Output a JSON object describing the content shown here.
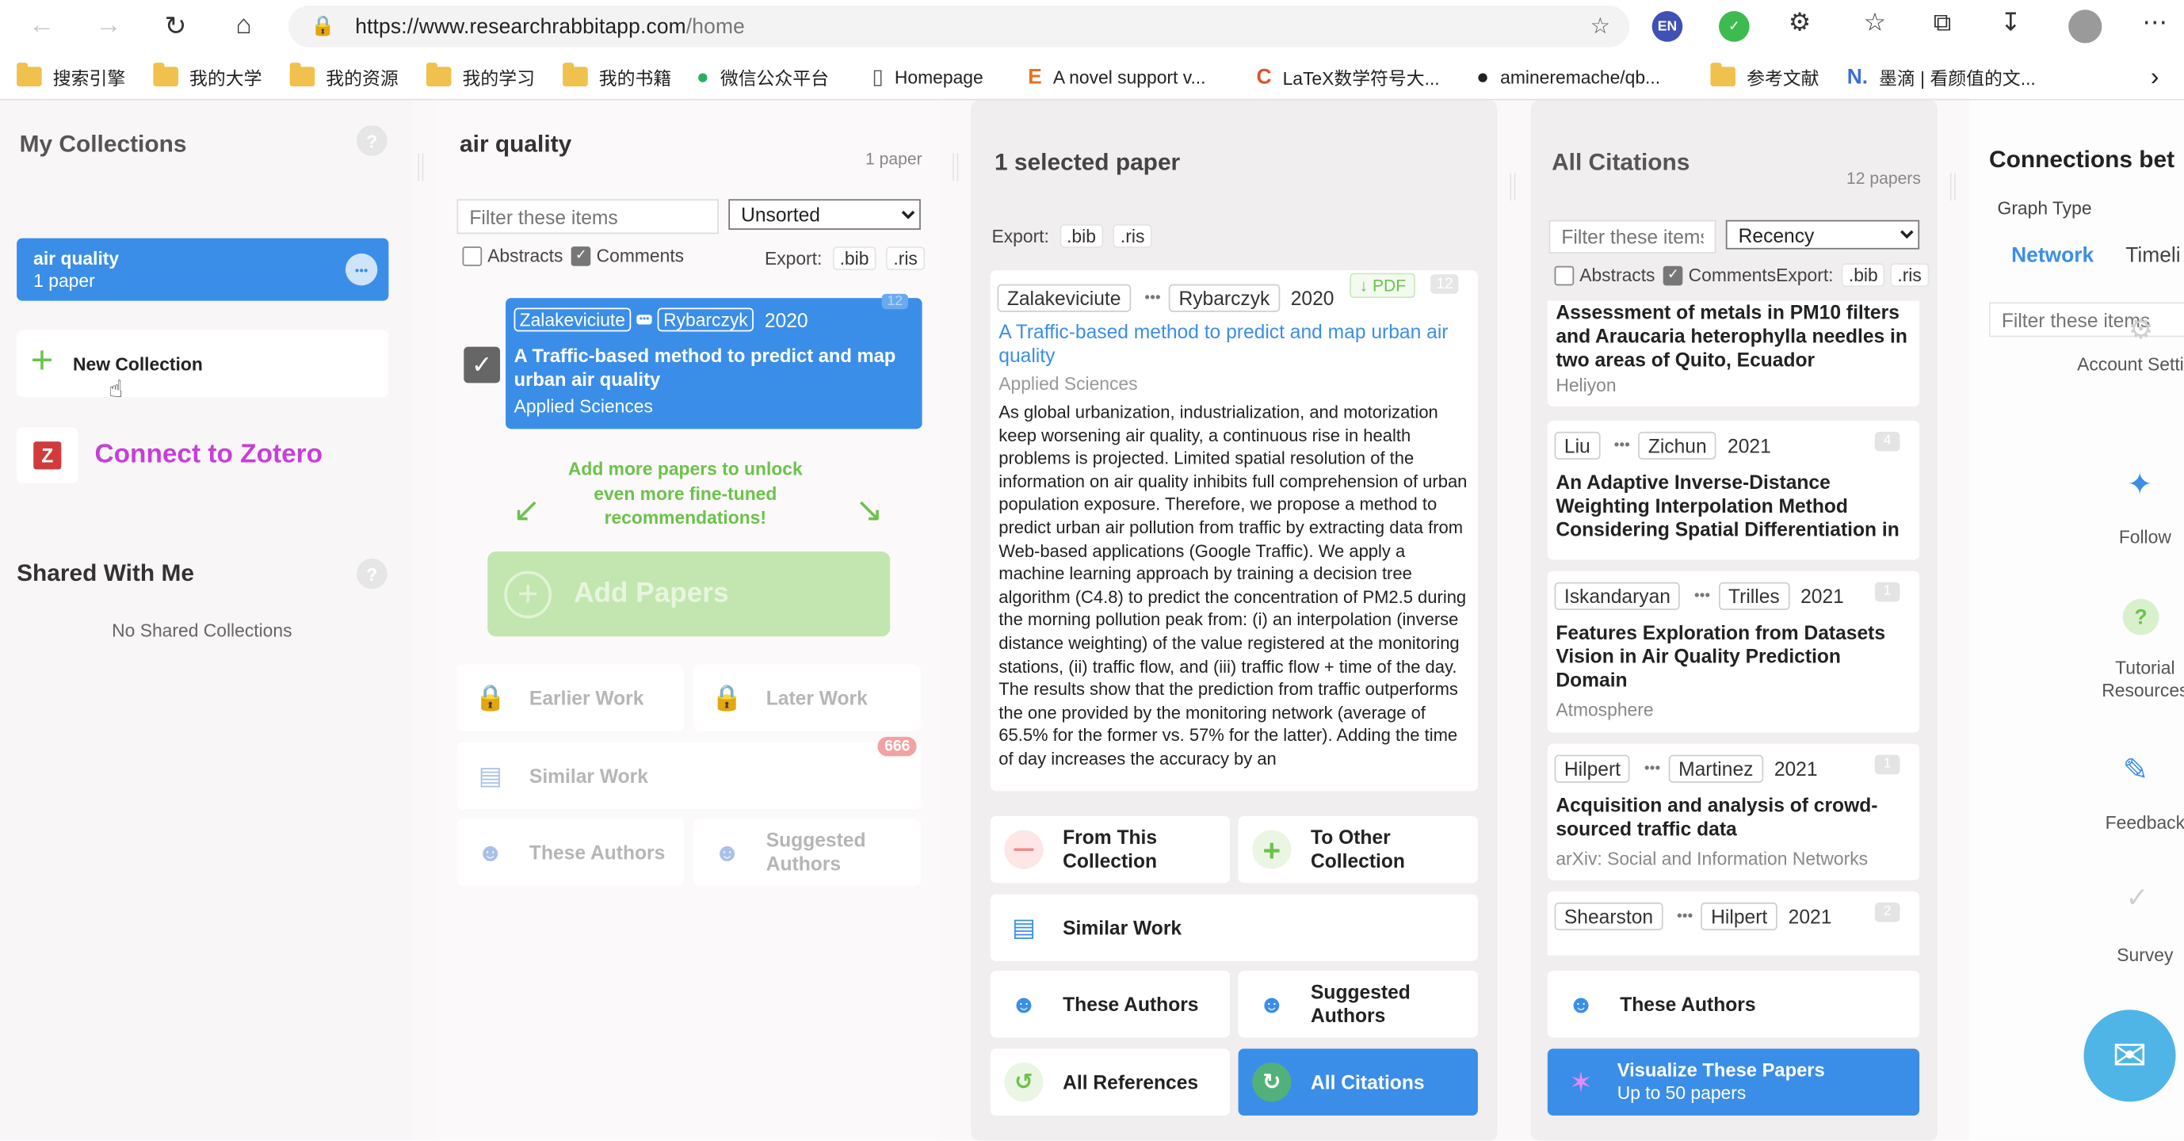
{
  "browser": {
    "url_host": "https://www.researchrabbitapp.com",
    "url_path": "/home",
    "bookmarks": [
      {
        "label": "搜索引擎",
        "icon": "folder-icon"
      },
      {
        "label": "我的大学",
        "icon": "folder-icon"
      },
      {
        "label": "我的资源",
        "icon": "folder-icon"
      },
      {
        "label": "我的学习",
        "icon": "folder-icon"
      },
      {
        "label": "我的书籍",
        "icon": "folder-icon"
      },
      {
        "label": "微信公众平台",
        "icon": "wechat-icon"
      },
      {
        "label": "Homepage",
        "icon": "page-icon"
      },
      {
        "label": "A novel support v...",
        "icon": "elsevier-icon"
      },
      {
        "label": "LaTeX数学符号大...",
        "icon": "csdn-icon"
      },
      {
        "label": "amineremache/qb...",
        "icon": "github-icon"
      },
      {
        "label": "参考文献",
        "icon": "folder-icon"
      },
      {
        "label": "墨滴 | 看颜值的文...",
        "icon": "mdnice-icon"
      }
    ],
    "ext_lang": "EN"
  },
  "collections": {
    "title": "My Collections",
    "help": "?",
    "active": {
      "name": "air quality",
      "count": "1 paper",
      "menu": "•••"
    },
    "new_collection": "New Collection",
    "zotero_letter": "Z",
    "zotero": "Connect to Zotero",
    "shared_title": "Shared With Me",
    "shared_help": "?",
    "shared_empty": "No Shared Collections"
  },
  "collection_panel": {
    "title": "air quality",
    "count": "1 paper",
    "filter_placeholder": "Filter these items",
    "sort": "Unsorted",
    "abstracts": "Abstracts",
    "comments": "Comments",
    "export_label": "Export:",
    "export_bib": ".bib",
    "export_ris": ".ris",
    "paper": {
      "author1": "Zalakeviciute",
      "dots": "•••",
      "author2": "Rybarczyk",
      "year": "2020",
      "cites": "12",
      "title": "A Traffic-based method to predict and map urban air quality",
      "journal": "Applied Sciences"
    },
    "hint": "Add more papers to unlock even more fine-tuned recommendations!",
    "add_papers": "Add Papers",
    "earlier": "Earlier Work",
    "later": "Later Work",
    "similar": "Similar Work",
    "similar_badge": "666",
    "these_authors": "These Authors",
    "suggested_authors": "Suggested Authors"
  },
  "selected": {
    "title": "1 selected paper",
    "export_label": "Export:",
    "export_bib": ".bib",
    "export_ris": ".ris",
    "author1": "Zalakeviciute",
    "dots": "•••",
    "author2": "Rybarczyk",
    "year": "2020",
    "pdf": "PDF",
    "cites": "12",
    "paper_title": "A Traffic-based method to predict and map urban air quality",
    "journal": "Applied Sciences",
    "abstract": "As global urbanization, industrialization, and motorization keep worsening air quality, a continuous rise in health problems is projected. Limited spatial resolution of the information on air quality inhibits full comprehension of urban population exposure. Therefore, we propose a method to predict urban air pollution from traffic by extracting data from Web-based applications (Google Traffic). We apply a machine learning approach by training a decision tree algorithm (C4.8) to predict the concentration of PM2.5 during the morning pollution peak from: (i) an interpolation (inverse distance weighting) of the value registered at the monitoring stations, (ii) traffic flow, and (iii) traffic flow + time of the day. The results show that the prediction from traffic outperforms the one provided by the monitoring network (average of 65.5% for the former vs. 57% for the latter). Adding the time of day increases the accuracy by an",
    "from_collection": "From This Collection",
    "to_collection": "To Other Collection",
    "similar": "Similar Work",
    "these_authors": "These Authors",
    "suggested_authors": "Suggested Authors",
    "all_references": "All References",
    "all_citations": "All Citations"
  },
  "citations": {
    "title": "All Citations",
    "count": "12 papers",
    "filter_placeholder": "Filter these items",
    "sort": "Recency",
    "abstracts": "Abstracts",
    "comments": "CommentsExport:",
    "export_bib": ".bib",
    "export_ris": ".ris",
    "items": [
      {
        "title": "Assessment of metals in PM10 filters and Araucaria heterophylla needles in two areas of Quito, Ecuador",
        "journal": "Heliyon"
      },
      {
        "author1": "Liu",
        "dots": "•••",
        "author2": "Zichun",
        "year": "2021",
        "cites": "4",
        "title": "An Adaptive Inverse-Distance Weighting Interpolation Method Considering Spatial Differentiation in"
      },
      {
        "author1": "Iskandaryan",
        "dots": "•••",
        "author2": "Trilles",
        "year": "2021",
        "cites": "1",
        "title": "Features Exploration from Datasets Vision in Air Quality Prediction Domain",
        "journal": "Atmosphere"
      },
      {
        "author1": "Hilpert",
        "dots": "•••",
        "author2": "Martinez",
        "year": "2021",
        "cites": "1",
        "title": "Acquisition and analysis of crowd-sourced traffic data",
        "journal": "arXiv: Social and Information Networks"
      },
      {
        "author1": "Shearston",
        "dots": "•••",
        "author2": "Hilpert",
        "year": "2021",
        "cites": "2"
      }
    ],
    "these_authors": "These Authors",
    "visualize": "Visualize These Papers",
    "visualize_sub": "Up to 50 papers"
  },
  "connections": {
    "title": "Connections bet",
    "graph_type": "Graph Type",
    "network": "Network",
    "timeline": "Timeli",
    "filter_placeholder": "Filter these items",
    "account": "Account Settings",
    "follow": "Follow",
    "tutorial": "Tutorial Resources",
    "feedback": "Feedback",
    "survey": "Survey"
  },
  "colors": {
    "accent": "#3b8ee8",
    "zotero": "#c63fd8",
    "green": "#6cc24a"
  }
}
